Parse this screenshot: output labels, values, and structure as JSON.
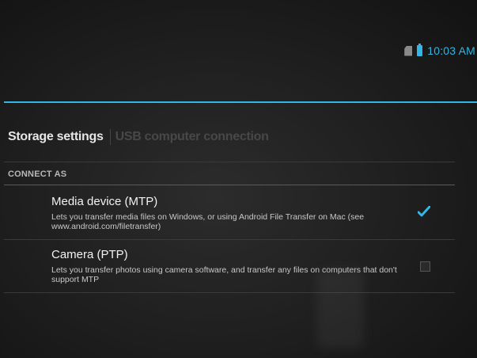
{
  "status": {
    "time": "10:03 AM",
    "sim_icon": "sim-card-icon",
    "battery_icon": "battery-icon",
    "accent_color": "#33b5e5"
  },
  "breadcrumb": {
    "parent": "Storage settings",
    "current": "USB computer connection"
  },
  "section": {
    "header": "CONNECT AS"
  },
  "options": [
    {
      "title": "Media device (MTP)",
      "summary": "Lets you transfer media files on Windows, or using Android File Transfer on Mac (see www.android.com/filetransfer)",
      "checked": true
    },
    {
      "title": "Camera (PTP)",
      "summary": "Lets you transfer photos using camera software, and transfer any files on computers that don't support MTP",
      "checked": false
    }
  ]
}
